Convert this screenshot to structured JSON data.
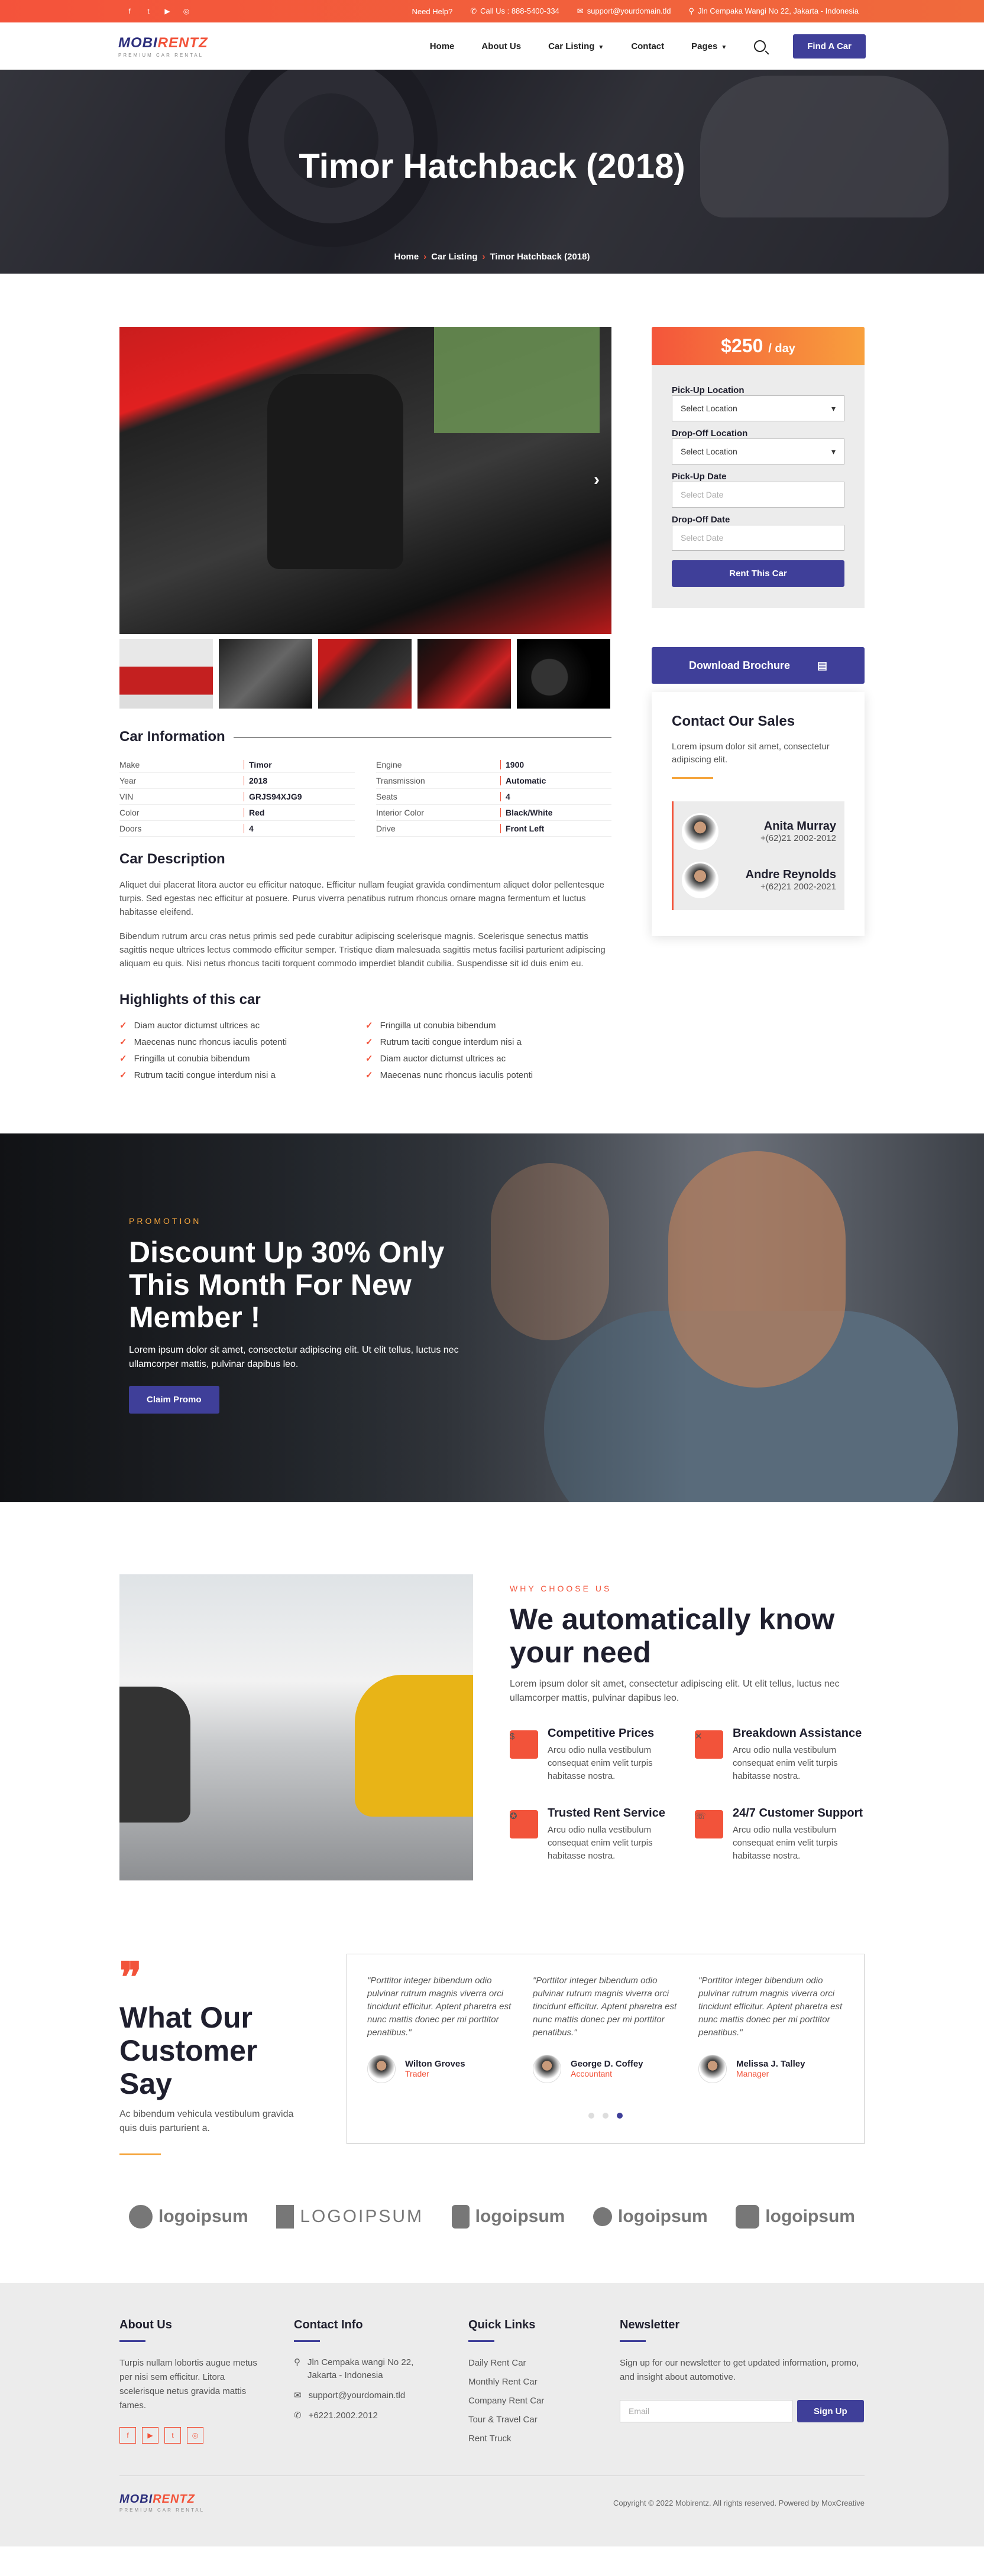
{
  "topbar": {
    "help": "Need Help?",
    "call": "Call Us : 888-5400-334",
    "email": "support@yourdomain.tld",
    "address": "Jln Cempaka Wangi No 22, Jakarta - Indonesia",
    "social": [
      "facebook",
      "twitter",
      "youtube",
      "instagram"
    ]
  },
  "header": {
    "logo_main": "MOBI",
    "logo_accent": "RENTZ",
    "logo_tag": "PREMIUM CAR RENTAL",
    "nav": [
      "Home",
      "About Us",
      "Car Listing",
      "Contact",
      "Pages"
    ],
    "cta": "Find A Car"
  },
  "hero": {
    "title": "Timor Hatchback (2018)",
    "crumbs": [
      "Home",
      "Car Listing",
      "Timor Hatchback (2018)"
    ]
  },
  "car_info": {
    "title": "Car Information",
    "rows_left": [
      {
        "k": "Make",
        "v": "Timor"
      },
      {
        "k": "Year",
        "v": "2018"
      },
      {
        "k": "VIN",
        "v": "GRJS94XJG9"
      },
      {
        "k": "Color",
        "v": "Red"
      },
      {
        "k": "Doors",
        "v": "4"
      }
    ],
    "rows_right": [
      {
        "k": "Engine",
        "v": "1900"
      },
      {
        "k": "Transmission",
        "v": "Automatic"
      },
      {
        "k": "Seats",
        "v": "4"
      },
      {
        "k": "Interior Color",
        "v": "Black/White"
      },
      {
        "k": "Drive",
        "v": "Front Left"
      }
    ]
  },
  "description": {
    "title": "Car Description",
    "p1": "Aliquet dui placerat litora auctor eu efficitur natoque. Efficitur nullam feugiat gravida condimentum aliquet dolor pellentesque turpis. Sed egestas nec efficitur at posuere. Purus viverra penatibus rutrum rhoncus ornare magna fermentum et luctus habitasse eleifend.",
    "p2": "Bibendum rutrum arcu cras netus primis sed pede curabitur adipiscing scelerisque magnis. Scelerisque senectus mattis sagittis neque ultrices lectus commodo efficitur semper. Tristique diam malesuada sagittis metus facilisi parturient adipiscing aliquam eu quis. Nisi netus rhoncus taciti torquent commodo imperdiet blandit cubilia. Suspendisse sit id duis enim eu."
  },
  "highlights": {
    "title": "Highlights of this car",
    "items": [
      "Diam auctor dictumst ultrices ac",
      "Fringilla ut conubia bibendum",
      "Maecenas nunc rhoncus iaculis potenti",
      "Rutrum taciti congue interdum nisi a",
      "Fringilla ut conubia bibendum",
      "Diam auctor dictumst ultrices ac",
      "Rutrum taciti congue interdum nisi a",
      "Maecenas nunc rhoncus iaculis potenti"
    ]
  },
  "booking": {
    "price": "$250",
    "per": "/ day",
    "pickup_loc_label": "Pick-Up Location",
    "pickup_loc_value": "Select Location",
    "drop_loc_label": "Drop-Off Location",
    "drop_loc_value": "Select Location",
    "pickup_date_label": "Pick-Up Date",
    "pickup_date_ph": "Select Date",
    "drop_date_label": "Drop-Off Date",
    "drop_date_ph": "Select Date",
    "rent_btn": "Rent This Car",
    "brochure": "Download Brochure"
  },
  "contact_sales": {
    "title": "Contact Our Sales",
    "text": "Lorem ipsum dolor sit amet, consectetur adipiscing elit.",
    "agents": [
      {
        "name": "Anita Murray",
        "phone": "+(62)21 2002-2012"
      },
      {
        "name": "Andre Reynolds",
        "phone": "+(62)21 2002-2021"
      }
    ]
  },
  "promo": {
    "eyebrow": "PROMOTION",
    "title": "Discount Up 30% Only This Month For New Member !",
    "text": "Lorem ipsum dolor sit amet, consectetur adipiscing elit. Ut elit tellus, luctus nec ullamcorper mattis, pulvinar dapibus leo.",
    "button": "Claim Promo"
  },
  "why": {
    "eyebrow": "WHY CHOOSE US",
    "title": "We automatically know your need",
    "text": "Lorem ipsum dolor sit amet, consectetur adipiscing elit. Ut elit tellus, luctus nec ullamcorper mattis, pulvinar dapibus leo.",
    "features": [
      {
        "title": "Competitive Prices",
        "text": "Arcu odio nulla vestibulum consequat enim velit turpis habitasse nostra.",
        "icon": "price-tag-icon"
      },
      {
        "title": "Breakdown Assistance",
        "text": "Arcu odio nulla vestibulum consequat enim velit turpis habitasse nostra.",
        "icon": "wrench-icon"
      },
      {
        "title": "Trusted Rent Service",
        "text": "Arcu odio nulla vestibulum consequat enim velit turpis habitasse nostra.",
        "icon": "badge-icon"
      },
      {
        "title": "24/7 Customer Support",
        "text": "Arcu odio nulla vestibulum consequat enim velit turpis habitasse nostra.",
        "icon": "support-icon"
      }
    ]
  },
  "testimonials": {
    "title": "What Our Customer Say",
    "text": "Ac bibendum vehicula vestibulum gravida quis duis parturient a.",
    "items": [
      {
        "quote": "\"Porttitor integer bibendum odio pulvinar rutrum magnis viverra orci tincidunt efficitur. Aptent pharetra est nunc mattis donec per mi porttitor penatibus.\"",
        "name": "Wilton Groves",
        "role": "Trader"
      },
      {
        "quote": "\"Porttitor integer bibendum odio pulvinar rutrum magnis viverra orci tincidunt efficitur. Aptent pharetra est nunc mattis donec per mi porttitor penatibus.\"",
        "name": "George D. Coffey",
        "role": "Accountant"
      },
      {
        "quote": "\"Porttitor integer bibendum odio pulvinar rutrum magnis viverra orci tincidunt efficitur. Aptent pharetra est nunc mattis donec per mi porttitor penatibus.\"",
        "name": "Melissa J. Talley",
        "role": "Manager"
      }
    ]
  },
  "logos": [
    "logoipsum",
    "LOGOIPSUM",
    "logoipsum",
    "logoipsum",
    "logoipsum"
  ],
  "footer": {
    "about_title": "About Us",
    "about_text": "Turpis nullam lobortis augue metus per nisi sem efficitur. Litora scelerisque netus gravida mattis fames.",
    "contact_title": "Contact Info",
    "contact_address": "Jln Cempaka wangi No 22, Jakarta - Indonesia",
    "contact_email": "support@yourdomain.tld",
    "contact_phone": "+6221.2002.2012",
    "links_title": "Quick Links",
    "links": [
      "Daily Rent Car",
      "Monthly Rent Car",
      "Company Rent Car",
      "Tour & Travel Car",
      "Rent Truck"
    ],
    "newsletter_title": "Newsletter",
    "newsletter_text": "Sign up for our newsletter to get updated information, promo, and insight about automotive.",
    "email_ph": "Email",
    "signup": "Sign Up",
    "copyright": "Copyright © 2022 Mobirentz. All rights reserved. Powered by MoxCreative"
  },
  "colors": {
    "accent": "#f2533a",
    "primary": "#3f3f99",
    "amber": "#f5a53d"
  }
}
